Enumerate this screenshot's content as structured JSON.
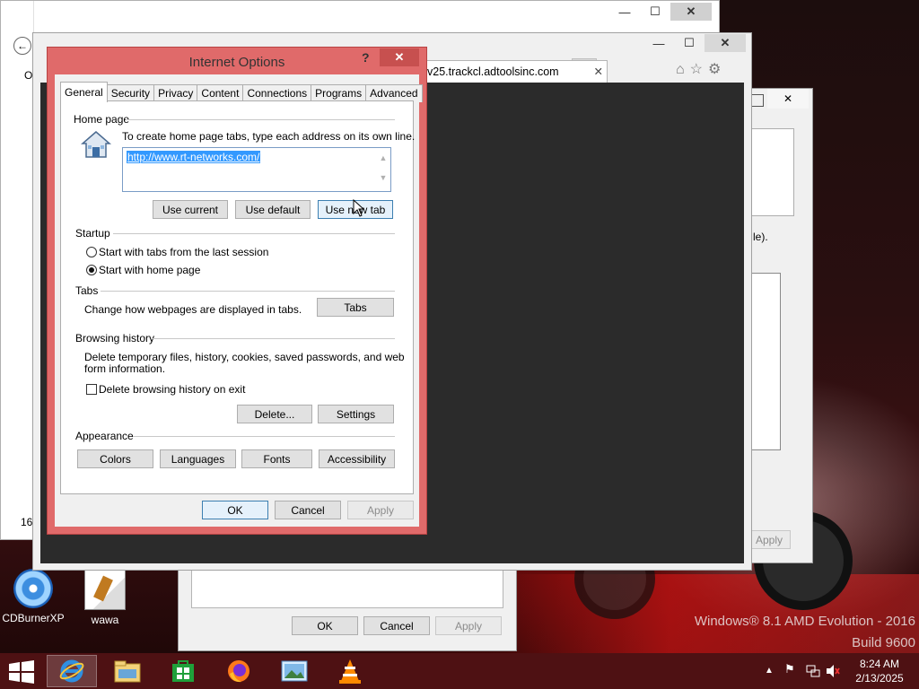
{
  "dialog": {
    "title": "Internet Options",
    "help": "?",
    "close": "✕",
    "tabs": [
      "General",
      "Security",
      "Privacy",
      "Content",
      "Connections",
      "Programs",
      "Advanced"
    ],
    "home_page": {
      "title": "Home page",
      "instruction": "To create home page tabs, type each address on its own line.",
      "url": "http://www.rt-networks.com/",
      "use_current": "Use current",
      "use_default": "Use default",
      "use_new_tab": "Use new tab"
    },
    "startup": {
      "title": "Startup",
      "option1": "Start with tabs from the last session",
      "option2": "Start with home page",
      "selected": "Start with home page"
    },
    "tabs_group": {
      "title": "Tabs",
      "description": "Change how webpages are displayed in tabs.",
      "button": "Tabs"
    },
    "browsing_history": {
      "title": "Browsing history",
      "description_line1": "Delete temporary files, history, cookies, saved passwords, and web",
      "description_line2": "form information.",
      "checkbox": "Delete browsing history on exit",
      "checkbox_checked": false,
      "delete": "Delete...",
      "settings": "Settings"
    },
    "appearance": {
      "title": "Appearance",
      "colors": "Colors",
      "languages": "Languages",
      "fonts": "Fonts",
      "accessibility": "Accessibility"
    },
    "footer": {
      "ok": "OK",
      "cancel": "Cancel",
      "apply": "Apply"
    }
  },
  "browser": {
    "tab_address": "v25.trackcl.adtoolsinc.com",
    "tab_close": "✕",
    "minimize": "—",
    "maximize": "☐",
    "close": "✕"
  },
  "background_window": {
    "text_fragment": "le).",
    "list_count": "16",
    "letter_o": "O",
    "apply": "Apply"
  },
  "bottom_dialog": {
    "ok": "OK",
    "cancel": "Cancel",
    "apply": "Apply"
  },
  "desktop": {
    "icons": [
      {
        "label": "CDBurnerXP",
        "icon": "cdburner-icon"
      },
      {
        "label": "wawa",
        "icon": "wawa-file-icon"
      }
    ],
    "watermark_line1": "Windows® 8.1 AMD Evolution - 2016",
    "watermark_line2": "Build 9600"
  },
  "taskbar": {
    "items": [
      "internet-explorer-icon",
      "file-explorer-icon",
      "store-icon",
      "firefox-icon",
      "photo-viewer-icon",
      "vlc-icon"
    ],
    "active_item": "internet-explorer-icon",
    "tray_icons": [
      "show-hidden-icons",
      "flag-icon",
      "network-icon",
      "volume-muted-icon"
    ],
    "time": "8:24 AM",
    "date": "2/13/2025"
  },
  "colors": {
    "dialog_frame": "#e06a6a",
    "close_button": "#c7504f",
    "selection": "#3399ff",
    "taskbar": "#4e1113"
  }
}
